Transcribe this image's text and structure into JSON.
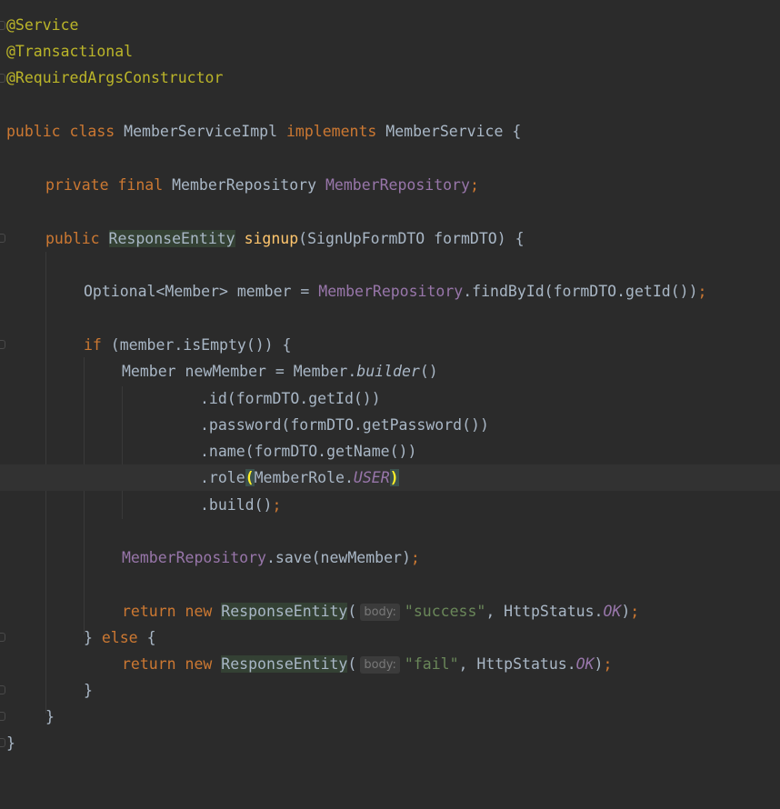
{
  "editor": {
    "accent_colors": {
      "background": "#2b2b2b",
      "annotation": "#bbb529",
      "keyword": "#cc7832",
      "field": "#9876aa",
      "method_declaration": "#ffc66d",
      "string": "#6a8759",
      "default_text": "#a9b7c6"
    },
    "tokens": {
      "service": "@Service",
      "transactional": "@Transactional",
      "required_args": "@RequiredArgsConstructor",
      "public": "public",
      "class": "class",
      "class_name": "MemberServiceImpl",
      "implements": "implements",
      "iface": "MemberService",
      "lbrace": "{",
      "rbrace": "}",
      "private": "private",
      "final": "final",
      "repo_type": "MemberRepository",
      "repo_field": "MemberRepository",
      "semi": ";",
      "response_entity": "ResponseEntity",
      "signup": "signup",
      "signup_params": "(SignUpFormDTO formDTO) {",
      "optional_decl": "Optional<Member> member = ",
      "find_call": ".findById(formDTO.getId())",
      "if": "if",
      "if_cond": " (member.isEmpty()) {",
      "new_member_decl": "Member newMember = Member.",
      "builder": "builder",
      "parens": "()",
      "id_call": ".id(formDTO.getId())",
      "password_call": ".password(formDTO.getPassword())",
      "name_call": ".name(formDTO.getName())",
      "role_prefix": ".role",
      "lparen": "(",
      "member_role": "MemberRole.",
      "user_const": "USER",
      "rparen": ")",
      "build_call": ".build()",
      "save_call": ".save(newMember)",
      "return": "return",
      "new": "new",
      "body_hint": "body:",
      "success_str": "\"success\"",
      "fail_str": "\"fail\"",
      "http_status": ", HttpStatus.",
      "ok_const": "OK",
      "close_paren": ")",
      "else": "else"
    }
  }
}
